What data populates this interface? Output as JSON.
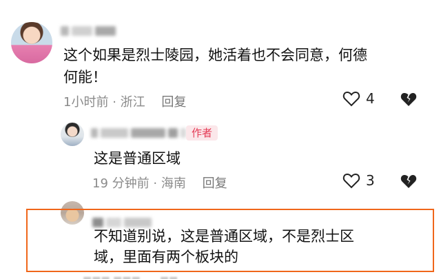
{
  "comments": [
    {
      "text_lines": [
        "这个如果是烈士陵园，她活着也不会同意，何德",
        "何能！"
      ],
      "time": "1小时前",
      "location": "浙江",
      "reply_label": "回复",
      "likes": "4"
    },
    {
      "badge": "作者",
      "text": "这是普通区域",
      "time": "19 分钟前",
      "location": "海南",
      "reply_label": "回复",
      "likes": "3"
    },
    {
      "text_lines": [
        "不知道别说，这是普通区域，不是烈士区",
        "域，里面有两个板块的"
      ]
    }
  ],
  "meta_separator": "·",
  "colors": {
    "highlight_border": "#f0661a",
    "author_badge_bg": "#fbe7ea",
    "author_badge_text": "#e43b55"
  },
  "icons": [
    "heart-outline-icon",
    "broken-heart-icon"
  ]
}
